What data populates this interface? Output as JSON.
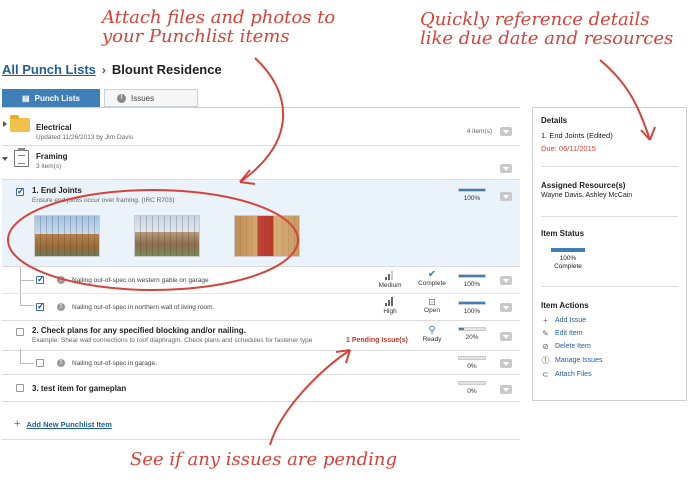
{
  "callouts": {
    "attach": "Attach files and photos to your Punchlist items",
    "details": "Quickly reference details like due date and resources",
    "issues": "See if any issues are pending"
  },
  "breadcrumb": {
    "root": "All Punch Lists",
    "current": "Blount Residence"
  },
  "tabs": [
    {
      "label": "Punch Lists",
      "icon": "checklist-icon",
      "active": true
    },
    {
      "label": "Issues",
      "icon": "alert-icon",
      "active": false
    }
  ],
  "groups": {
    "electrical": {
      "title": "Electrical",
      "sub": "Updated 11/26/2013 by Jim Davis",
      "count": "4 item(s)"
    },
    "framing": {
      "title": "Framing",
      "sub": "3 item(s)"
    }
  },
  "items": [
    {
      "title": "1. End Joints",
      "desc": "Ensure end joints occur over framing. (IRC R703)",
      "progress": 100,
      "progress_label": "100%",
      "issues": [
        {
          "text": "Nailing out-of-spec on western gable on garage",
          "priority": "Medium",
          "status": "Complete",
          "progress": 100,
          "progress_label": "100%"
        },
        {
          "text": "Nailing out-of-spec in northern wall of living room.",
          "priority": "High",
          "status": "Open",
          "progress": 100,
          "progress_label": "100%"
        }
      ]
    },
    {
      "title": "2. Check plans for any specified blocking and/or nailing.",
      "desc": "Example: Shear wall connections to roof diaphragm. Check plans and schedules for fastener type",
      "pending": "1 Pending Issue(s)",
      "status": "Ready",
      "progress": 20,
      "progress_label": "20%",
      "issues": [
        {
          "text": "Nailing out-of-spec in garage.",
          "progress": 0,
          "progress_label": "0%"
        }
      ]
    },
    {
      "title": "3. test item for gameplan",
      "progress": 0,
      "progress_label": "0%"
    }
  ],
  "add_item_label": "Add New Punchlist Item",
  "details": {
    "header": "Details",
    "item_name": "1. End Joints (Edited)",
    "due": "Due: 06/11/2015",
    "resources_header": "Assigned Resource(s)",
    "resources": "Wayne Davis, Ashley McCain",
    "status_header": "Item Status",
    "status_progress": 100,
    "status_label": "100%",
    "status_sub": "Complete",
    "actions_header": "Item Actions",
    "actions": [
      "Add Issue",
      "Edit Item",
      "Delete Item",
      "Manage Issues",
      "Attach Files"
    ]
  },
  "colors": {
    "accent": "#3f7fb8",
    "annotation": "#d9423a",
    "link": "#1f5f9e"
  }
}
